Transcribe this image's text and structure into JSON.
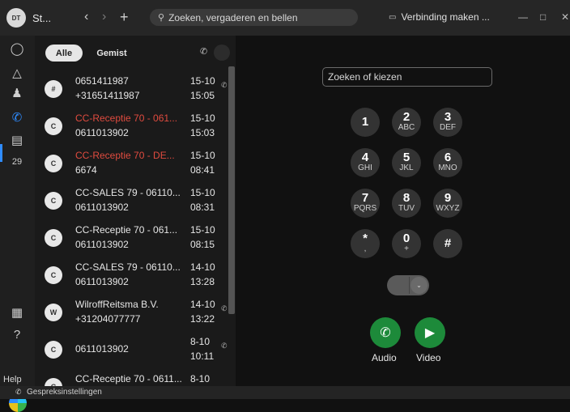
{
  "titlebar": {
    "avatar_initials": "DT",
    "app_title": "St...",
    "back_icon": "‹",
    "forward_icon": "›",
    "new_icon": "+",
    "search_placeholder": "Zoeken, vergaderen en bellen",
    "connect_label": "Verbinding maken ..."
  },
  "list": {
    "tab_all": "Alle",
    "tab_missed": "Gemist",
    "rows": [
      {
        "initial": "#",
        "line1": "0651411987",
        "line2": "+31651411987",
        "date": "15-10",
        "time": "15:05",
        "missed": false
      },
      {
        "initial": "C",
        "line1": "CC-Receptie 70 - 061...",
        "line2": "0611013902",
        "date": "15-10",
        "time": "15:03",
        "missed": true
      },
      {
        "initial": "C",
        "line1": "CC-Receptie 70 - DE...",
        "line2": "6674",
        "date": "15-10",
        "time": "08:41",
        "missed": true
      },
      {
        "initial": "C",
        "line1": "CC-SALES 79 - 06110...",
        "line2": "0611013902",
        "date": "15-10",
        "time": "08:31",
        "missed": false
      },
      {
        "initial": "C",
        "line1": "CC-Receptie 70 - 061...",
        "line2": "0611013902",
        "date": "15-10",
        "time": "08:15",
        "missed": false
      },
      {
        "initial": "C",
        "line1": "CC-SALES 79 - 06110...",
        "line2": "0611013902",
        "date": "14-10",
        "time": "13:28",
        "missed": false
      },
      {
        "initial": "W",
        "line1": "WilroffReitsma B.V.",
        "line2": "+31204077777",
        "date": "14-10",
        "time": "13:22",
        "missed": false
      },
      {
        "initial": "C",
        "line1": "0611013902",
        "line2": "",
        "date": "8-10",
        "time": "10:11",
        "missed": false
      },
      {
        "initial": "C",
        "line1": "CC-Receptie 70 - 0611...",
        "line2": "",
        "date": "8-10",
        "time": "",
        "missed": false
      }
    ]
  },
  "leftnav": {
    "help_label": "Help"
  },
  "dialpad": {
    "input_placeholder": "Zoeken of kiezen",
    "keys": [
      {
        "num": "1",
        "letters": ""
      },
      {
        "num": "2",
        "letters": "ABC"
      },
      {
        "num": "3",
        "letters": "DEF"
      },
      {
        "num": "4",
        "letters": "GHI"
      },
      {
        "num": "5",
        "letters": "JKL"
      },
      {
        "num": "6",
        "letters": "MNO"
      },
      {
        "num": "7",
        "letters": "PQRS"
      },
      {
        "num": "8",
        "letters": "TUV"
      },
      {
        "num": "9",
        "letters": "WXYZ"
      },
      {
        "num": "*",
        "letters": ","
      },
      {
        "num": "0",
        "letters": "+"
      },
      {
        "num": "#",
        "letters": ""
      }
    ],
    "audio_label": "Audio",
    "video_label": "Video"
  },
  "statusbar": {
    "label": "Gespreksinstellingen"
  },
  "colors": {
    "accent": "#2f8cff",
    "missed": "#e04b3f",
    "call_green": "#1d8a3a"
  }
}
